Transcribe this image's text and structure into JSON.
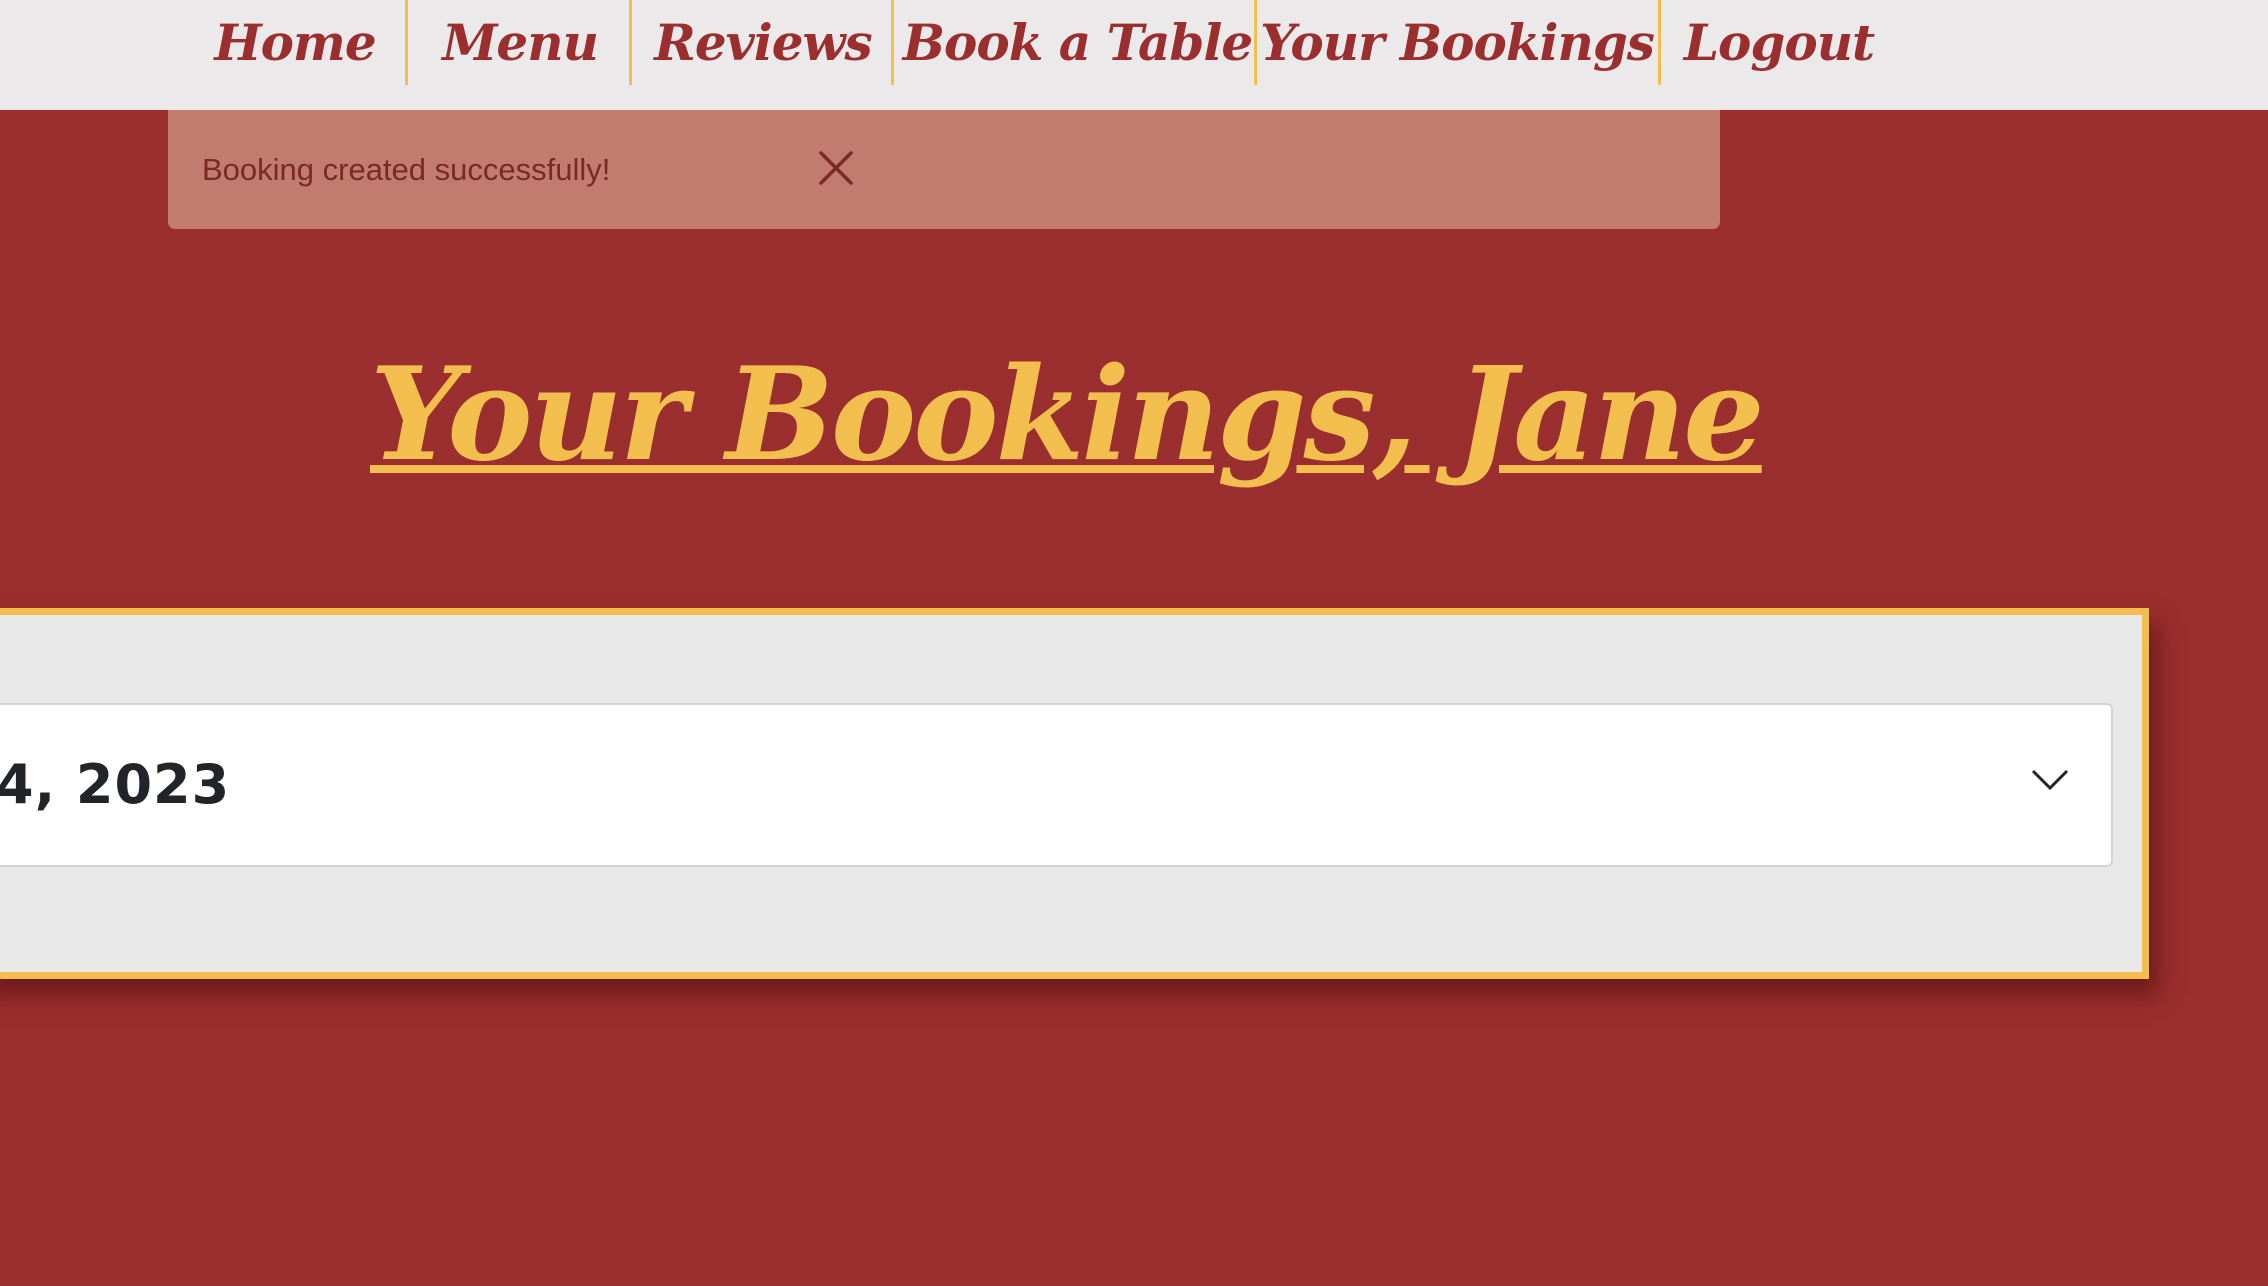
{
  "nav": {
    "items": [
      {
        "label": "Home"
      },
      {
        "label": "Menu"
      },
      {
        "label": "Reviews"
      },
      {
        "label": "Book a Table"
      },
      {
        "label": "Your Bookings"
      },
      {
        "label": "Logout"
      }
    ]
  },
  "alert": {
    "message": "Booking created successfully!",
    "close_icon": "close-icon"
  },
  "main": {
    "title": "Your Bookings, Jane"
  },
  "booking_card": {
    "header_label": "4, 2023",
    "expand_icon": "chevron-down-icon"
  },
  "colors": {
    "background": "#9b2e2e",
    "accent": "#f2bf4f",
    "nav_background": "#ebe9e9",
    "alert_background": "#c17b6f"
  }
}
